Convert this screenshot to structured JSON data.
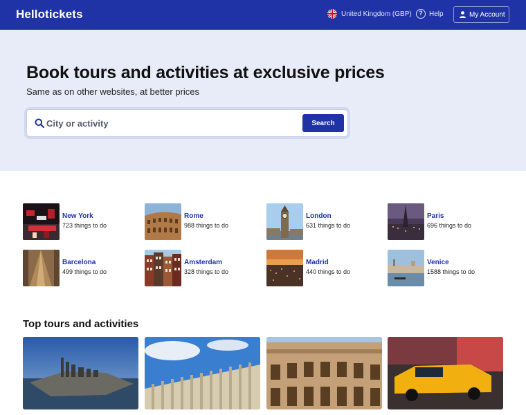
{
  "header": {
    "logo": "Hellotickets",
    "locale": "United Kingdom (GBP)",
    "help": "Help",
    "account": "My Account"
  },
  "hero": {
    "title": "Book tours and activities at exclusive prices",
    "subtitle": "Same as on other websites, at better prices",
    "search_placeholder": "City or activity",
    "search_button": "Search"
  },
  "destinations": [
    {
      "name": "New York",
      "count": "723 things to do"
    },
    {
      "name": "Rome",
      "count": "988 things to do"
    },
    {
      "name": "London",
      "count": "631 things to do"
    },
    {
      "name": "Paris",
      "count": "696 things to do"
    },
    {
      "name": "Barcelona",
      "count": "499 things to do"
    },
    {
      "name": "Amsterdam",
      "count": "328 things to do"
    },
    {
      "name": "Madrid",
      "count": "440 things to do"
    },
    {
      "name": "Venice",
      "count": "1588 things to do"
    }
  ],
  "top_tours": {
    "title": "Top tours and activities"
  },
  "colors": {
    "brand": "#1f33a6",
    "hero_bg": "#e8ecf8"
  }
}
